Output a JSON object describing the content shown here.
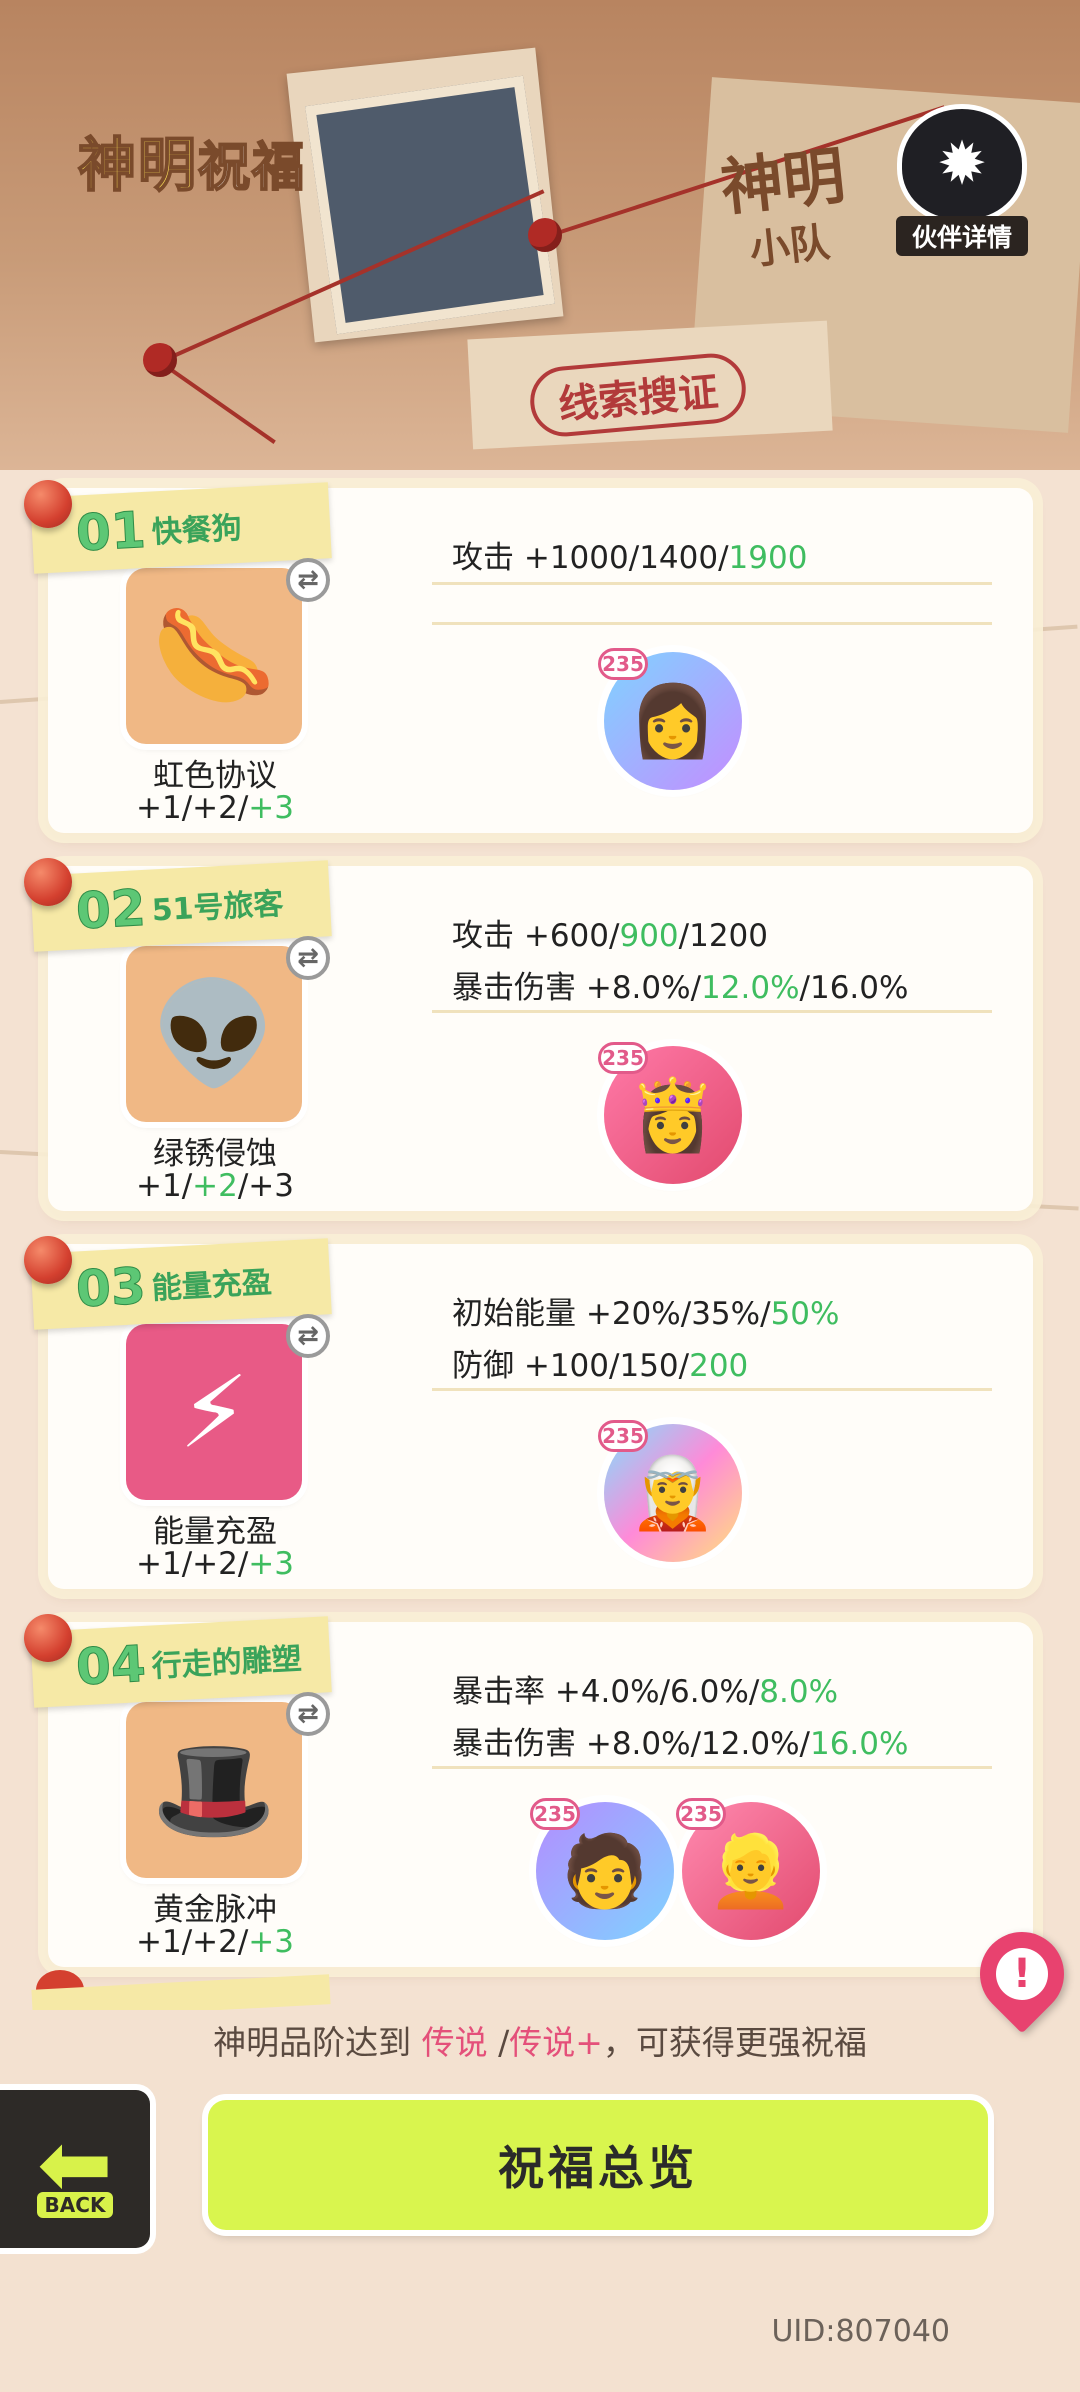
{
  "header": {
    "title_part1": "神明",
    "title_part2": "祝福",
    "team_label_line1": "神明",
    "team_label_line2": "小队",
    "clue_label": "线索搜证",
    "partner_details_label": "伙伴详情"
  },
  "cards": [
    {
      "number": "01",
      "deity_name": "快餐狗",
      "blessing_name": "虹色协议",
      "levels": [
        "+1",
        "+2",
        "+3"
      ],
      "active_level_index": 2,
      "stats": [
        {
          "label": "攻击",
          "values": [
            "+1000",
            "1400",
            "1900"
          ],
          "active_index": 2
        }
      ],
      "partners": [
        {
          "level": "235"
        }
      ]
    },
    {
      "number": "02",
      "deity_name": "51号旅客",
      "blessing_name": "绿锈侵蚀",
      "levels": [
        "+1",
        "+2",
        "+3"
      ],
      "active_level_index": 1,
      "stats": [
        {
          "label": "攻击",
          "values": [
            "+600",
            "900",
            "1200"
          ],
          "active_index": 1
        },
        {
          "label": "暴击伤害",
          "values": [
            "+8.0%",
            "12.0%",
            "16.0%"
          ],
          "active_index": 1
        }
      ],
      "partners": [
        {
          "level": "235"
        }
      ]
    },
    {
      "number": "03",
      "deity_name": "能量充盈",
      "blessing_name": "能量充盈",
      "levels": [
        "+1",
        "+2",
        "+3"
      ],
      "active_level_index": 2,
      "stats": [
        {
          "label": "初始能量",
          "values": [
            "+20%",
            "35%",
            "50%"
          ],
          "active_index": 2
        },
        {
          "label": "防御",
          "values": [
            "+100",
            "150",
            "200"
          ],
          "active_index": 2
        }
      ],
      "partners": [
        {
          "level": "235"
        }
      ]
    },
    {
      "number": "04",
      "deity_name": "行走的雕塑",
      "blessing_name": "黄金脉冲",
      "levels": [
        "+1",
        "+2",
        "+3"
      ],
      "active_level_index": 2,
      "stats": [
        {
          "label": "暴击率",
          "values": [
            "+4.0%",
            "6.0%",
            "8.0%"
          ],
          "active_index": 2
        },
        {
          "label": "暴击伤害",
          "values": [
            "+8.0%",
            "12.0%",
            "16.0%"
          ],
          "active_index": 2
        }
      ],
      "partners": [
        {
          "level": "235"
        },
        {
          "level": "235"
        }
      ]
    }
  ],
  "hint": {
    "prefix": "神明品阶达到 ",
    "tier1": "传说",
    "separator": " /",
    "tier2": "传说+",
    "suffix": "，可获得更强祝福"
  },
  "back_button_label": "BACK",
  "overview_button_label": "祝福总览",
  "uid_text": "UID:807040",
  "colors": {
    "active_value": "#3fbd60",
    "highlight_tier": "#e4507a",
    "overview_button": "#d9f54e",
    "tag_background": "#f6e9a6"
  }
}
